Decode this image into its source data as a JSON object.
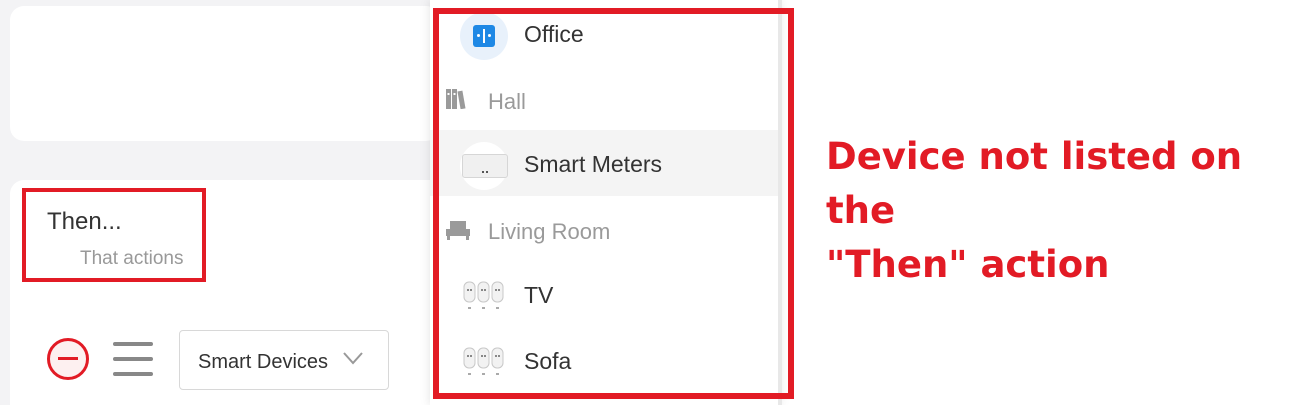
{
  "then_section": {
    "title": "Then...",
    "subtitle": "That actions"
  },
  "action_row": {
    "select_value": "Smart Devices"
  },
  "dropdown": {
    "items": [
      {
        "type": "device",
        "label": "Office",
        "icon": "switch-device-icon"
      },
      {
        "type": "group",
        "label": "Hall",
        "icon": "books-icon"
      },
      {
        "type": "device",
        "label": "Smart Meters",
        "icon": "smart-meter-icon",
        "highlighted": true
      },
      {
        "type": "group",
        "label": "Living Room",
        "icon": "sofa-icon"
      },
      {
        "type": "device",
        "label": "TV",
        "icon": "smart-plugs-icon"
      },
      {
        "type": "device",
        "label": "Sofa",
        "icon": "smart-plugs-icon"
      }
    ]
  },
  "annotation": {
    "line1": "Device not listed on the",
    "line2": "\"Then\" action"
  },
  "colors": {
    "annotation_red": "#e21b25",
    "accent_blue": "#1e88e5"
  }
}
